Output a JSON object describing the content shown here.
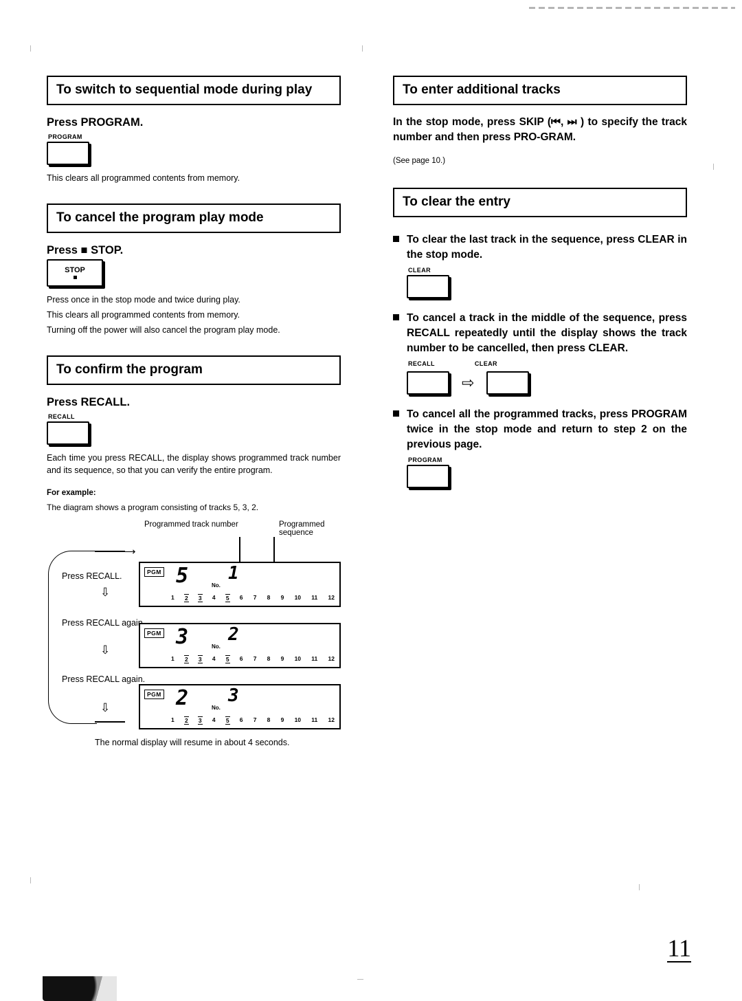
{
  "page": {
    "number": "11"
  },
  "left": {
    "sec1": {
      "heading": "To switch to sequential mode during play",
      "press": "Press PROGRAM.",
      "button_label": "PROGRAM",
      "note": "This clears all programmed contents from memory."
    },
    "sec2": {
      "heading": "To cancel the program play mode",
      "press": "Press ■ STOP.",
      "button_text": "STOP",
      "note1": "Press once in the stop mode and twice during play.",
      "note2": "This clears all programmed contents from memory.",
      "note3": "Turning off the power will also cancel the program play mode."
    },
    "sec3": {
      "heading": "To confirm the program",
      "press": "Press RECALL.",
      "button_label": "RECALL",
      "note": "Each time you press RECALL, the display shows programmed track number and its sequence, so that you can verify the entire program.",
      "example_title": "For example:",
      "example_text": "The diagram shows a program consisting of tracks 5, 3, 2.",
      "caption_track": "Programmed track number",
      "caption_sequence": "Programmed sequence",
      "steps": [
        "Press RECALL.",
        "Press RECALL again.",
        "Press RECALL again."
      ],
      "displays": [
        {
          "pgm": "PGM",
          "number": "5",
          "no": "No.",
          "sequence": "1"
        },
        {
          "pgm": "PGM",
          "number": "3",
          "no": "No.",
          "sequence": "2"
        },
        {
          "pgm": "PGM",
          "number": "2",
          "no": "No.",
          "sequence": "3"
        }
      ],
      "scale": [
        "1",
        "2",
        "3",
        "4",
        "5",
        "6",
        "7",
        "8",
        "9",
        "10",
        "11",
        "12"
      ],
      "scale_highlight": [
        1,
        2,
        4
      ],
      "resume_note": "The normal display will resume in about 4 seconds."
    }
  },
  "right": {
    "sec1": {
      "heading": "To enter additional tracks",
      "body": "In the stop mode, press SKIP (⏮, ⏭ ) to specify the track number and then press PRO-GRAM.",
      "see_page": "(See page 10.)"
    },
    "sec2": {
      "heading": "To clear the entry",
      "bullets": [
        {
          "text": "To clear the last track in the sequence, press CLEAR in the stop mode.",
          "buttons": [
            {
              "label": "CLEAR"
            }
          ]
        },
        {
          "text": "To cancel a track in the middle of the sequence, press RECALL repeatedly until the display shows the track number to be cancelled, then press CLEAR.",
          "buttons": [
            {
              "label": "RECALL"
            },
            {
              "label": "CLEAR"
            }
          ],
          "arrow": "⇨"
        },
        {
          "text": "To cancel all the programmed tracks, press PROGRAM twice in the stop mode and return to step 2 on the previous page.",
          "buttons": [
            {
              "label": "PROGRAM"
            }
          ]
        }
      ]
    }
  }
}
